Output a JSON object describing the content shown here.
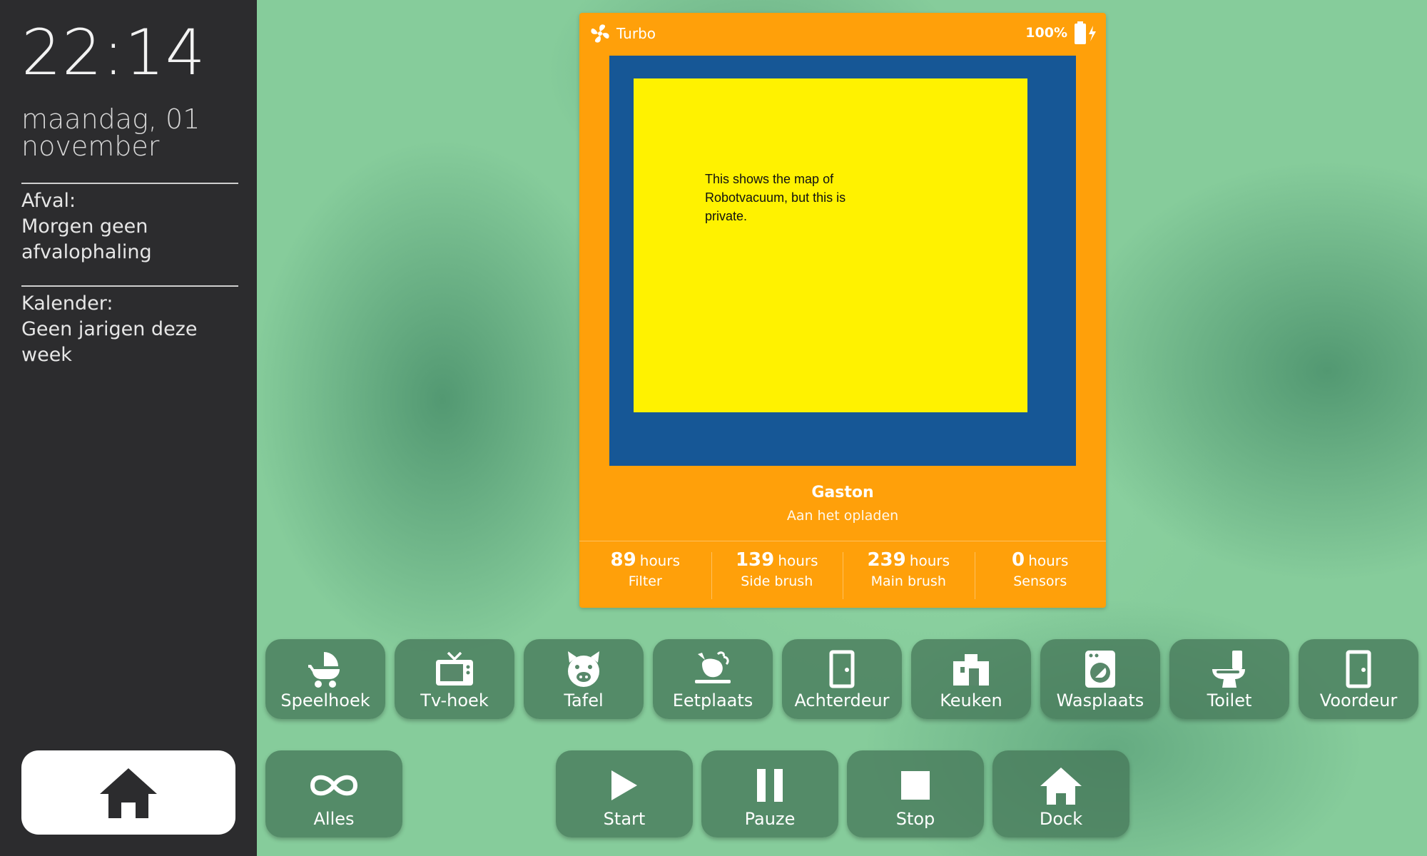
{
  "sidebar": {
    "time": "22:14",
    "date": "maandag, 01 november",
    "waste_title": "Afval:",
    "waste_text": "Morgen geen afvalophaling",
    "calendar_title": "Kalender:",
    "calendar_text": "Geen jarigen deze week",
    "home_icon": "home-icon"
  },
  "vacuum": {
    "fan_mode": "Turbo",
    "battery": "100%",
    "map_note": "This shows the map of Robotvacuum, but this is private.",
    "name": "Gaston",
    "status": "Aan het opladen",
    "unit": "hours",
    "stats": [
      {
        "value": "89",
        "label": "Filter"
      },
      {
        "value": "139",
        "label": "Side brush"
      },
      {
        "value": "239",
        "label": "Main brush"
      },
      {
        "value": "0",
        "label": "Sensors"
      }
    ],
    "colors": {
      "card": "#ffa00a",
      "map_border": "#165796",
      "map_fill": "#fff200"
    }
  },
  "rooms": [
    {
      "label": "Speelhoek",
      "icon": "baby-carriage-icon"
    },
    {
      "label": "Tv-hoek",
      "icon": "tv-icon"
    },
    {
      "label": "Tafel",
      "icon": "pig-icon"
    },
    {
      "label": "Eetplaats",
      "icon": "food-turkey-icon"
    },
    {
      "label": "Achterdeur",
      "icon": "door-icon"
    },
    {
      "label": "Keuken",
      "icon": "fridge-icon"
    },
    {
      "label": "Wasplaats",
      "icon": "washing-machine-icon"
    },
    {
      "label": "Toilet",
      "icon": "toilet-icon"
    },
    {
      "label": "Voordeur",
      "icon": "door-icon"
    }
  ],
  "actions": [
    {
      "label": "Alles",
      "icon": "infinity-icon"
    },
    {
      "label": "Start",
      "icon": "play-icon"
    },
    {
      "label": "Pauze",
      "icon": "pause-icon"
    },
    {
      "label": "Stop",
      "icon": "stop-icon"
    },
    {
      "label": "Dock",
      "icon": "home-icon"
    }
  ]
}
